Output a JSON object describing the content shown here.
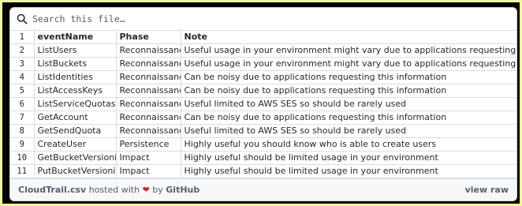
{
  "search": {
    "placeholder": "Search this file…"
  },
  "table": {
    "headers": [
      "eventName",
      "Phase",
      "Note"
    ],
    "rows": [
      {
        "n": "2",
        "event": "ListUsers",
        "phase": "Reconnaissance",
        "note": "Useful usage in your environment might vary due to applications requesting this information"
      },
      {
        "n": "3",
        "event": "ListBuckets",
        "phase": "Reconnaissance",
        "note": "Useful usage in your environment might vary due to applications requesting this information"
      },
      {
        "n": "4",
        "event": "ListIdentities",
        "phase": "Reconnaissance",
        "note": "Can be noisy due to applications requesting this information"
      },
      {
        "n": "5",
        "event": "ListAccessKeys",
        "phase": "Reconnaissance",
        "note": "Can be noisy due to applications requesting this information"
      },
      {
        "n": "6",
        "event": "ListServiceQuotas",
        "phase": "Reconnaissance",
        "note": "Useful limited to AWS SES so should be rarely used"
      },
      {
        "n": "7",
        "event": "GetAccount",
        "phase": "Reconnaissance",
        "note": "Can be noisy due to applications requesting this information"
      },
      {
        "n": "8",
        "event": "GetSendQuota",
        "phase": "Reconnaissance",
        "note": "Useful limited to AWS SES so should be rarely used"
      },
      {
        "n": "9",
        "event": "CreateUser",
        "phase": "Persistence",
        "note": "Highly useful you should know who is able to create users"
      },
      {
        "n": "10",
        "event": "GetBucketVersioning",
        "phase": "Impact",
        "note": "Highly useful should be limited usage in your environment"
      },
      {
        "n": "11",
        "event": "PutBucketVersioning",
        "phase": "Impact",
        "note": "Highly useful should be limited usage in your environment"
      }
    ]
  },
  "footer": {
    "filename": "CloudTrail.csv",
    "hosted_text": "hosted with",
    "heart": "❤",
    "by_text": "by",
    "host": "GitHub",
    "view_raw": "view raw"
  }
}
